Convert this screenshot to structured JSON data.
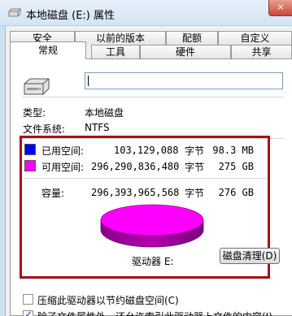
{
  "window": {
    "title": "本地磁盘 (E:) 属性",
    "close_label": "×",
    "drive_icon": "drive-icon"
  },
  "tabs_row1": [
    "安全",
    "以前的版本",
    "配额",
    "自定义"
  ],
  "tabs_row2": [
    "常规",
    "工具",
    "硬件",
    "共享"
  ],
  "active_tab": "常规",
  "general": {
    "name_value": "",
    "type_label": "类型:",
    "type_value": "本地磁盘",
    "fs_label": "文件系统:",
    "fs_value": "NTFS",
    "used": {
      "label": "已用空间:",
      "bytes": "103,129,088",
      "unit": "字节",
      "size": "98.3 MB",
      "color": "#0000ff"
    },
    "free": {
      "label": "可用空间:",
      "bytes": "296,290,836,480",
      "unit": "字节",
      "size": "275 GB",
      "color": "#ff00ff"
    },
    "capacity": {
      "label": "容量:",
      "bytes": "296,393,965,568",
      "unit": "字节",
      "size": "276 GB"
    },
    "drive_label": "驱动器 E:",
    "cleanup_button": "磁盘清理(D)",
    "pie_color": "#ff00ff",
    "highlight_color": "#a0121b"
  },
  "options": {
    "compress_label": "压缩此驱动器以节约磁盘空间(C)",
    "compress_checked": false,
    "index_label": "除了文件属性外，还允许索引此驱动器上文件的内容(I)",
    "index_checked": true
  }
}
